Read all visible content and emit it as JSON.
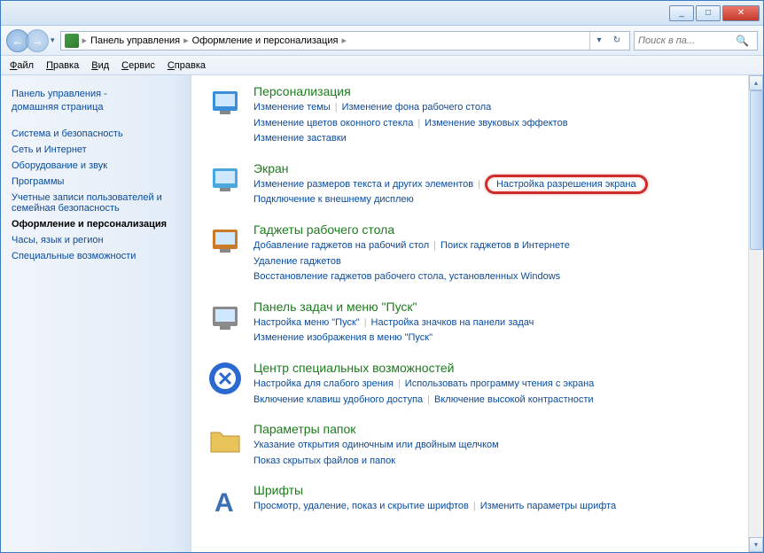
{
  "titlebar": {
    "min": "_",
    "max": "□",
    "close": "✕"
  },
  "nav": {
    "back": "←",
    "fwd": "→",
    "dropdown": "▾"
  },
  "breadcrumb": {
    "root": "Панель управления",
    "current": "Оформление и персонализация"
  },
  "addr_buttons": {
    "dropdown": "▾",
    "refresh": "↻"
  },
  "search": {
    "placeholder": "Поиск в па...",
    "icon": "🔍"
  },
  "menu": [
    "Файл",
    "Правка",
    "Вид",
    "Сервис",
    "Справка"
  ],
  "sidebar": {
    "home": "Панель управления -\nдомашняя страница",
    "items": [
      {
        "label": "Система и безопасность",
        "active": false
      },
      {
        "label": "Сеть и Интернет",
        "active": false
      },
      {
        "label": "Оборудование и звук",
        "active": false
      },
      {
        "label": "Программы",
        "active": false
      },
      {
        "label": "Учетные записи пользователей и семейная безопасность",
        "active": false
      },
      {
        "label": "Оформление и персонализация",
        "active": true
      },
      {
        "label": "Часы, язык и регион",
        "active": false
      },
      {
        "label": "Специальные возможности",
        "active": false
      }
    ]
  },
  "categories": [
    {
      "icon": "personalization",
      "title": "Персонализация",
      "links": [
        [
          "Изменение темы",
          "Изменение фона рабочего стола"
        ],
        [
          "Изменение цветов оконного стекла",
          "Изменение звуковых эффектов"
        ],
        [
          "Изменение заставки"
        ]
      ]
    },
    {
      "icon": "display",
      "title": "Экран",
      "links": [
        [
          "Изменение размеров текста и других элементов",
          {
            "text": "Настройка разрешения экрана",
            "highlight": true
          }
        ],
        [
          "Подключение к внешнему дисплею"
        ]
      ]
    },
    {
      "icon": "gadgets",
      "title": "Гаджеты рабочего стола",
      "links": [
        [
          "Добавление гаджетов на рабочий стол",
          "Поиск гаджетов в Интернете"
        ],
        [
          "Удаление гаджетов"
        ],
        [
          "Восстановление гаджетов рабочего стола, установленных Windows"
        ]
      ]
    },
    {
      "icon": "taskbar",
      "title": "Панель задач и меню \"Пуск\"",
      "links": [
        [
          "Настройка меню \"Пуск\"",
          "Настройка значков на панели задач"
        ],
        [
          "Изменение изображения в меню \"Пуск\""
        ]
      ]
    },
    {
      "icon": "ease",
      "title": "Центр специальных возможностей",
      "links": [
        [
          "Настройка для слабого зрения",
          "Использовать программу чтения с экрана"
        ],
        [
          "Включение клавиш удобного доступа",
          "Включение высокой контрастности"
        ]
      ]
    },
    {
      "icon": "folders",
      "title": "Параметры папок",
      "links": [
        [
          "Указание открытия одиночным или двойным щелчком"
        ],
        [
          "Показ скрытых файлов и папок"
        ]
      ]
    },
    {
      "icon": "fonts",
      "title": "Шрифты",
      "links": [
        [
          "Просмотр, удаление, показ и скрытие шрифтов",
          "Изменить параметры шрифта"
        ]
      ]
    }
  ]
}
